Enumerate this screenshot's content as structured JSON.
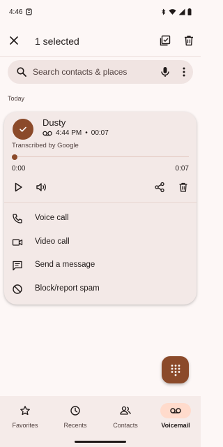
{
  "status_bar": {
    "time": "4:46"
  },
  "app_bar": {
    "title": "1 selected"
  },
  "search": {
    "placeholder": "Search contacts & places"
  },
  "section": {
    "label": "Today"
  },
  "voicemail": {
    "caller": "Dusty",
    "time": "4:44 PM",
    "separator": "•",
    "duration": "00:07",
    "transcription_note": "Transcribed by Google",
    "playback_position": 0,
    "time_start": "0:00",
    "time_end": "0:07"
  },
  "actions": [
    {
      "label": "Voice call",
      "icon": "phone-icon"
    },
    {
      "label": "Video call",
      "icon": "videocam-icon"
    },
    {
      "label": "Send a message",
      "icon": "message-icon"
    },
    {
      "label": "Block/report spam",
      "icon": "block-icon"
    }
  ],
  "bottom_nav": [
    {
      "label": "Favorites",
      "icon": "star-icon",
      "active": false
    },
    {
      "label": "Recents",
      "icon": "clock-icon",
      "active": false
    },
    {
      "label": "Contacts",
      "icon": "people-icon",
      "active": false
    },
    {
      "label": "Voicemail",
      "icon": "voicemail-icon",
      "active": true
    }
  ],
  "colors": {
    "accent": "#8b4a2a",
    "active_indicator": "#ffdbcc",
    "background": "#fdf7f6",
    "card": "#f3e9e7"
  }
}
